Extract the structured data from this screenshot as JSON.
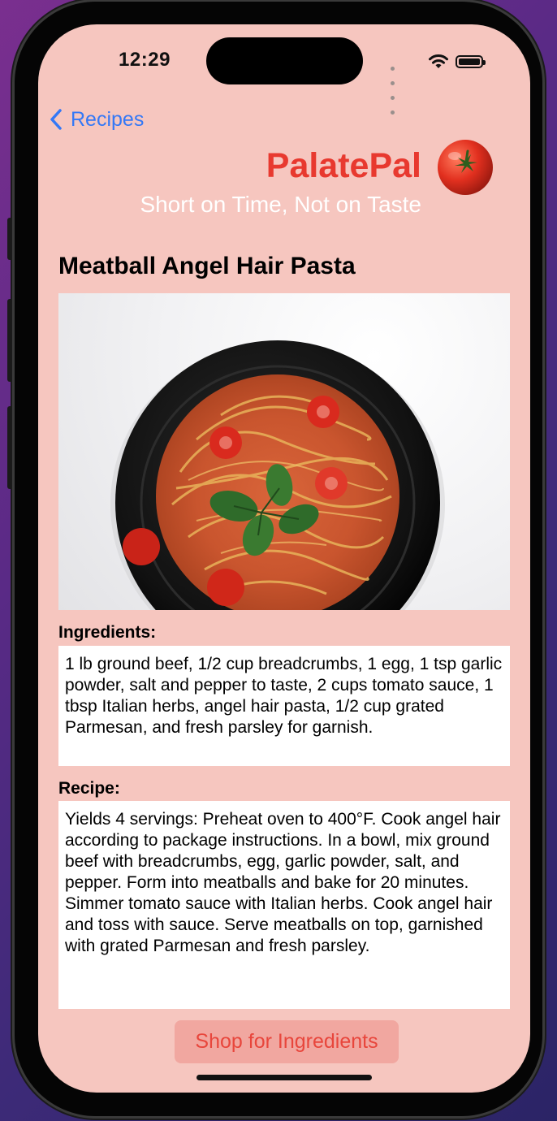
{
  "status_bar": {
    "time": "12:29"
  },
  "nav": {
    "back_label": "Recipes"
  },
  "header": {
    "brand": "PalatePal",
    "tagline": "Short on Time, Not on Taste"
  },
  "recipe": {
    "title": "Meatball Angel Hair Pasta",
    "image_alt": "Plate of spaghetti with tomato sauce, cherry tomatoes and basil",
    "ingredients_label": "Ingredients:",
    "ingredients": "1 lb ground beef, 1/2 cup breadcrumbs, 1 egg, 1 tsp garlic powder, salt and pepper to taste, 2 cups tomato sauce, 1 tbsp Italian herbs, angel hair pasta, 1/2 cup grated Parmesan, and fresh parsley for garnish.",
    "recipe_label": "Recipe:",
    "instructions": "Yields 4 servings: Preheat oven to 400°F. Cook angel hair according to package instructions. In a bowl, mix ground beef with breadcrumbs, egg, garlic powder, salt, and pepper. Form into meatballs and bake for 20 minutes. Simmer tomato sauce with Italian herbs. Cook angel hair and toss with sauce. Serve meatballs on top, garnished with grated Parmesan and fresh parsley."
  },
  "actions": {
    "shop_label": "Shop for Ingredients"
  },
  "colors": {
    "background": "#f6c6bf",
    "brand": "#e8392f",
    "link": "#3478f6",
    "button_bg": "#f1a7a0",
    "button_text": "#e8463c"
  },
  "icons": [
    "chevron-left-icon",
    "tomato-logo-icon",
    "wifi-icon",
    "battery-icon"
  ]
}
